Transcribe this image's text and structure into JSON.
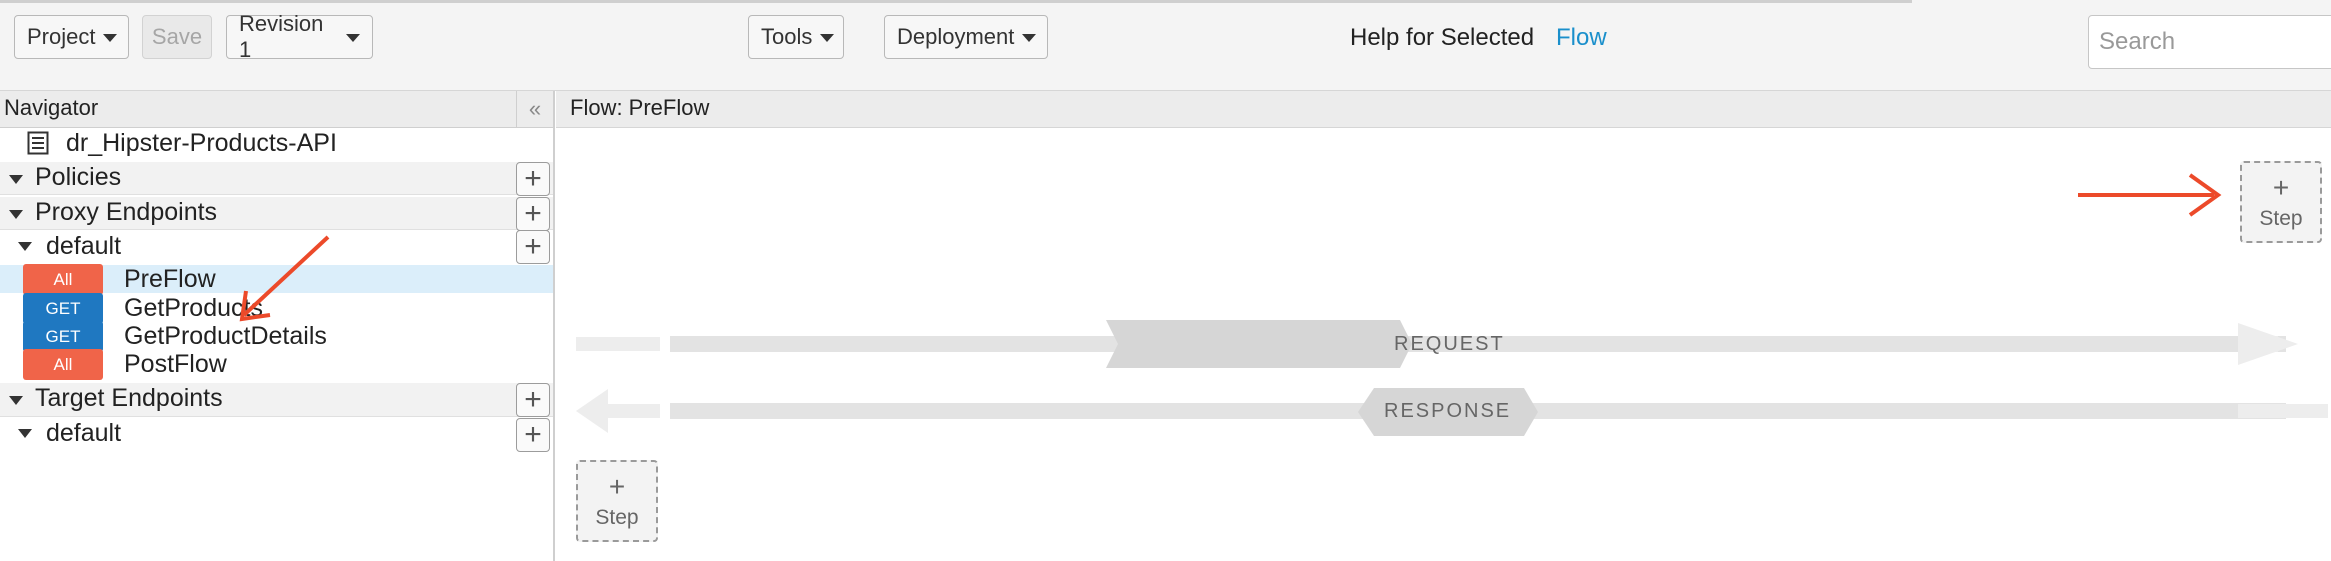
{
  "toolbar": {
    "project_label": "Project",
    "save_label": "Save",
    "revision_label": "Revision 1",
    "tools_label": "Tools",
    "deployment_label": "Deployment",
    "help_text": "Help for Selected",
    "help_link": "Flow",
    "search_placeholder": "Search"
  },
  "navigator": {
    "title": "Navigator",
    "collapse_glyph": "«",
    "api_name": "dr_Hipster-Products-API",
    "policies_label": "Policies",
    "proxy_endpoints_label": "Proxy Endpoints",
    "proxy_default_label": "default",
    "flows": [
      {
        "method": "All",
        "name": "PreFlow"
      },
      {
        "method": "GET",
        "name": "GetProducts"
      },
      {
        "method": "GET",
        "name": "GetProductDetails"
      },
      {
        "method": "All",
        "name": "PostFlow"
      }
    ],
    "target_endpoints_label": "Target Endpoints",
    "target_default_label": "default",
    "plus_glyph": "+"
  },
  "canvas": {
    "title": "Flow: PreFlow",
    "step_plus": "+",
    "step_label": "Step",
    "request_label": "REQUEST",
    "response_label": "RESPONSE"
  },
  "colors": {
    "method_all": "#f06449",
    "method_get": "#1f78c1",
    "link": "#1a8fcb",
    "annotation_arrow": "#ec4a2a",
    "selected_row": "#dbeefa"
  },
  "icons": {
    "api_proxy": "document-list-icon",
    "dropdown": "caret-down-icon",
    "expand": "triangle-down-icon",
    "add": "plus-icon",
    "collapse": "double-chevron-left-icon"
  }
}
